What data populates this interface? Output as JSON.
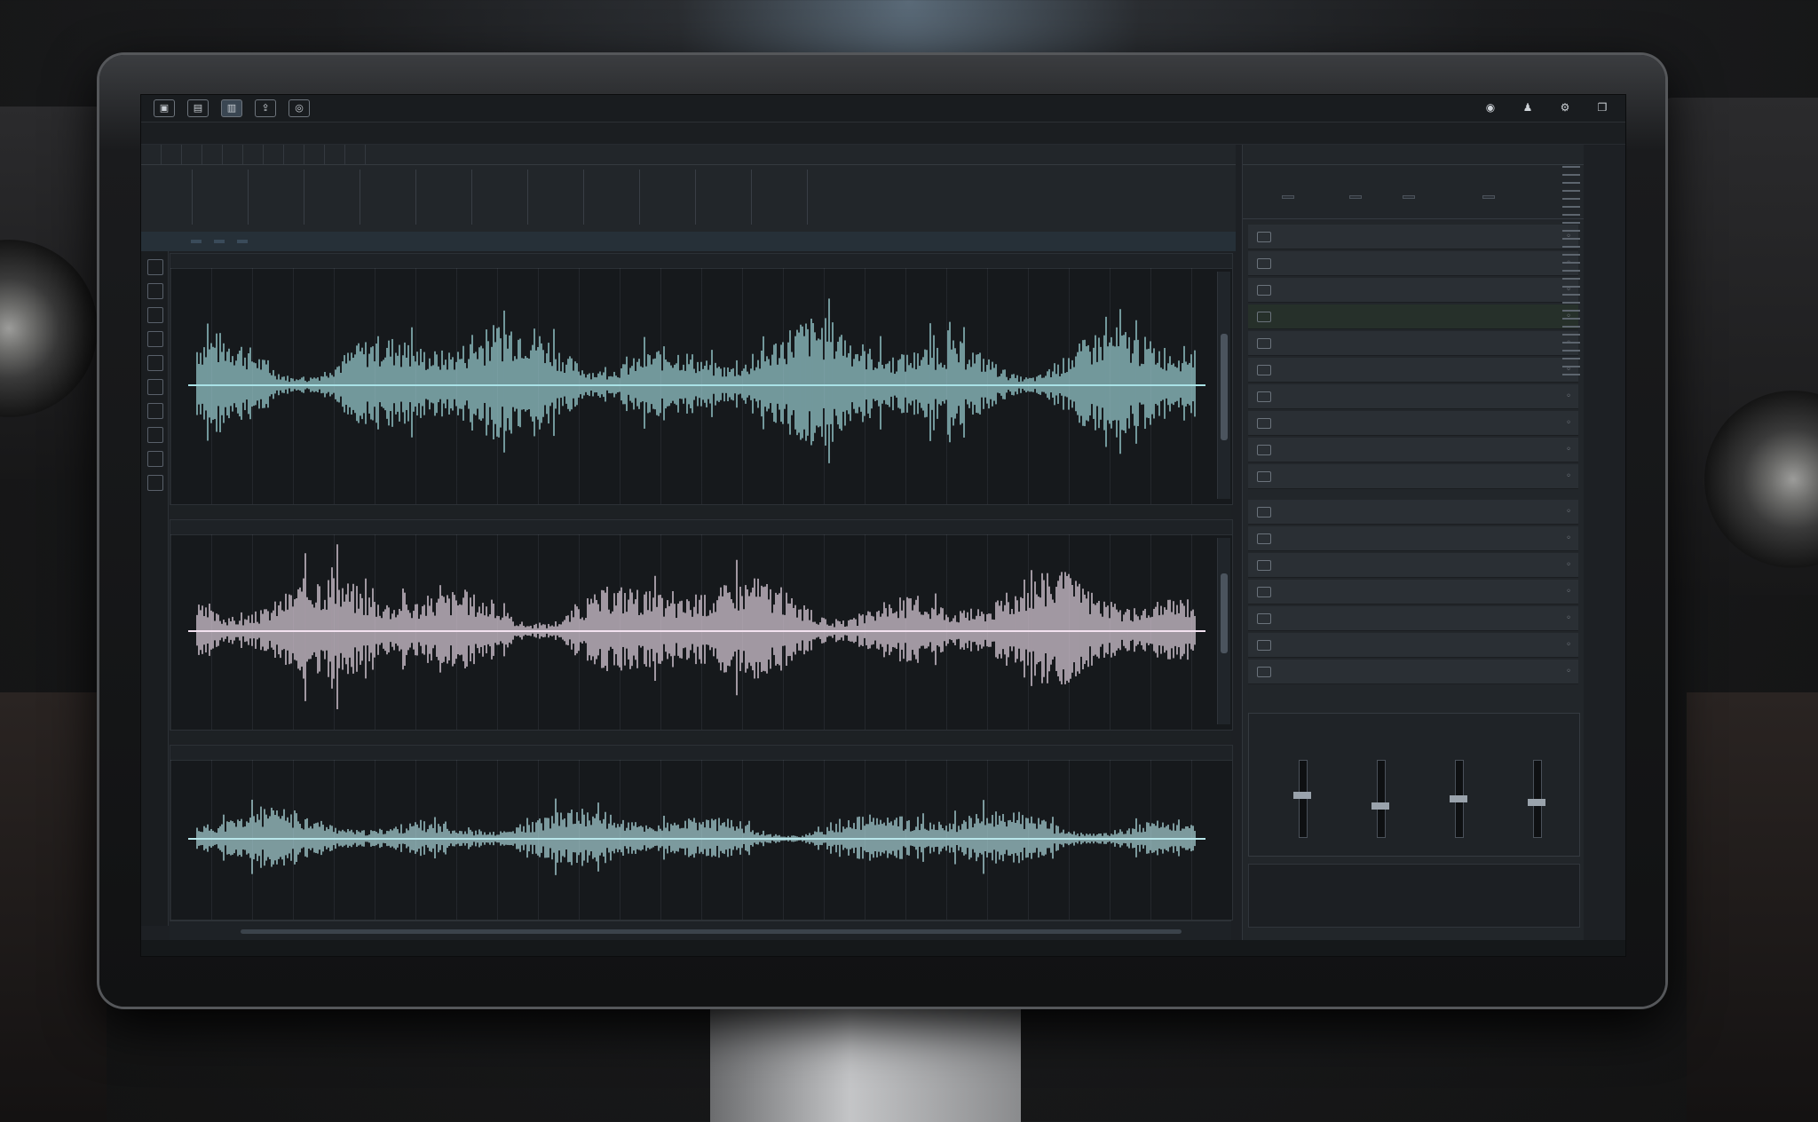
{
  "topbar": {
    "left_text": "",
    "icons": [
      "file-icon",
      "save-icon",
      "folder-icon",
      "export-icon",
      "settings-icon"
    ],
    "right_icons": [
      "help-icon",
      "user-icon",
      "gear-icon",
      "window-icon"
    ]
  },
  "menu": {
    "items": [
      "",
      "",
      "",
      "",
      "",
      "",
      "",
      "",
      "",
      ""
    ]
  },
  "transport": {
    "tabs": [
      "",
      "",
      "",
      "",
      "",
      "",
      "",
      "",
      "",
      "",
      ""
    ],
    "counters": [
      {
        "big": "",
        "small": ""
      },
      {
        "big": "",
        "small": ""
      },
      {
        "big": "",
        "small": ""
      },
      {
        "big": "",
        "small": ""
      },
      {
        "big": "",
        "small": ""
      },
      {
        "big": "",
        "small": ""
      },
      {
        "big": "",
        "small": ""
      },
      {
        "big": "",
        "small": ""
      },
      {
        "big": "",
        "small": ""
      },
      {
        "big": "",
        "small": ""
      },
      {
        "big": "",
        "small": ""
      },
      {
        "big": "",
        "small": ""
      }
    ],
    "right_label": "",
    "right_value": "",
    "zoom_items": [
      "",
      "",
      "",
      "",
      "",
      ""
    ]
  },
  "tracks": [
    {
      "label": "",
      "color": "#a9e2e6"
    },
    {
      "label": "",
      "color": "#f3e2f0"
    },
    {
      "label": "",
      "color": "#b8e6ea"
    }
  ],
  "right_panel": {
    "title": "",
    "control_1": "",
    "control_2": "",
    "buttons": [
      "",
      "",
      "",
      ""
    ],
    "rows": [
      "",
      "",
      "",
      "",
      "",
      "",
      "",
      "",
      "",
      ""
    ],
    "rows_2": [
      "",
      "",
      "",
      "",
      "",
      "",
      ""
    ],
    "meters": [
      {
        "ch": "",
        "val": "",
        "level": 0.55
      },
      {
        "ch": "",
        "val": "",
        "level": 0.4
      },
      {
        "ch": "",
        "val": "",
        "level": 0.5
      },
      {
        "ch": "",
        "val": "",
        "level": 0.45
      }
    ]
  },
  "status": {
    "left": "",
    "right": ""
  },
  "hscroll": {
    "label": ""
  }
}
